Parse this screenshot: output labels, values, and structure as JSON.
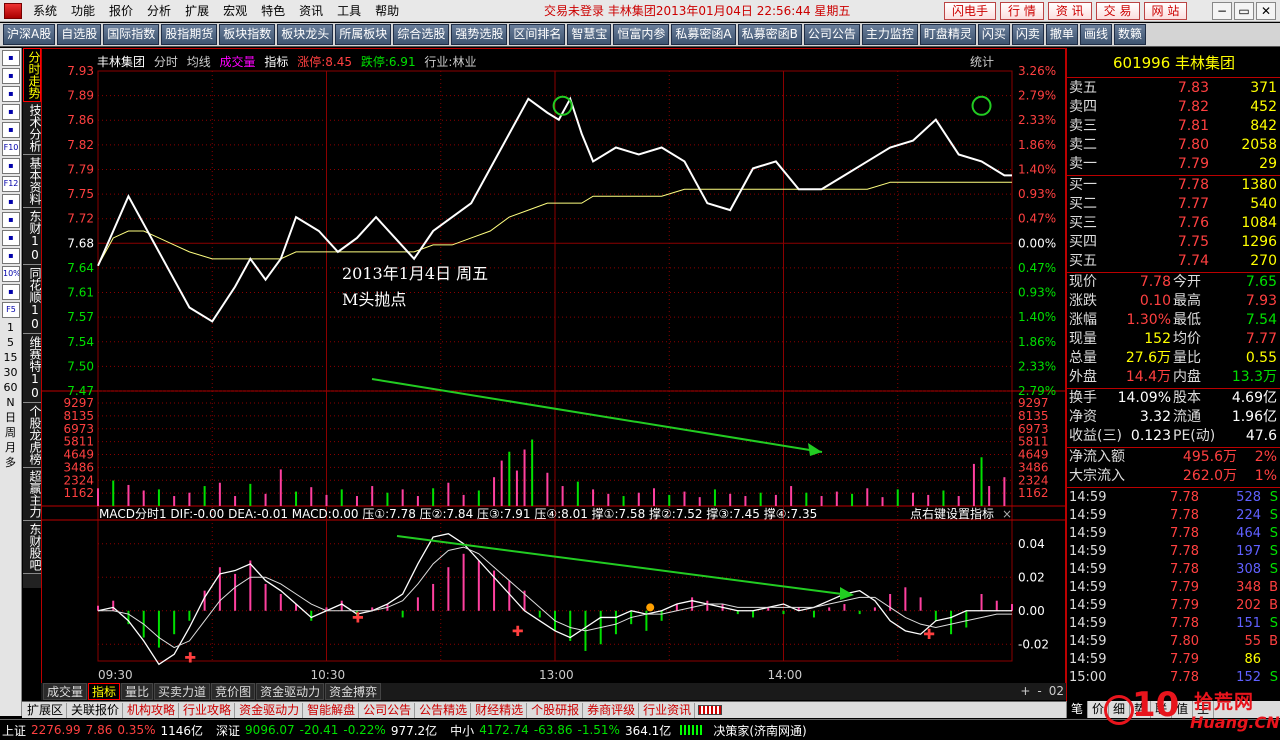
{
  "menubar": {
    "items": [
      "系统",
      "功能",
      "报价",
      "分析",
      "扩展",
      "宏观",
      "特色",
      "资讯",
      "工具",
      "帮助"
    ],
    "title": "交易未登录   丰林集团2013年01月04日  22:56:44  星期五",
    "quick_buttons": [
      "闪电手",
      "行 情",
      "资 讯",
      "交 易",
      "网 站"
    ],
    "window_controls": [
      "−",
      "▭",
      "✕"
    ]
  },
  "toolbar": {
    "items": [
      "沪深A股",
      "自选股",
      "国际指数",
      "股指期货",
      "板块指数",
      "板块龙头",
      "所属板块",
      "综合选股",
      "强势选股",
      "区间排名",
      "智慧宝",
      "恒富内参",
      "私募密函A",
      "私募密函B",
      "公司公告",
      "主力监控",
      "盯盘精灵",
      "闪买",
      "闪卖",
      "撤单",
      "画线",
      "数籁"
    ]
  },
  "leftbar": {
    "icons": [
      "list-icon",
      "grid-icon",
      "chart-icon",
      "table-icon",
      "window-icon",
      "F10",
      "doc-icon",
      "F12",
      "search-icon",
      "link-icon",
      "bar-icon",
      "monitor-icon",
      "10%",
      "pencil-icon",
      "F5"
    ],
    "labels": [
      "1",
      "5",
      "15",
      "30",
      "60",
      "N",
      "日",
      "周",
      "月",
      "多"
    ]
  },
  "vtabs": [
    "分时走势",
    "技术分析",
    "基本资料",
    "东财10",
    "同花顺10",
    "维赛特10",
    "个股龙虎榜",
    "超赢主力",
    "东财股吧"
  ],
  "chart": {
    "header": {
      "stock": "丰林集团",
      "mode": "分时",
      "avg_label": "均线",
      "vol_label": "成交量",
      "ind_label": "指标",
      "limit_up": "涨停:8.45",
      "limit_down": "跌停:6.91",
      "industry": "行业:林业"
    },
    "stats_label": "统计",
    "annotation_line1": "2013年1月4日  周五",
    "annotation_line2": "M头抛点",
    "macd_header": "MACD分时1  DIF:-0.00  DEA:-0.01  MACD:0.00  压①:7.78  压②:7.84  压③:7.91  压④:8.01  撑①:7.58  撑②:7.52  撑③:7.45  撑④:7.35",
    "macd_hint": "点右键设置指标",
    "time_labels": [
      "09:30",
      "10:30",
      "13:00",
      "14:00"
    ]
  },
  "chart_data": [
    {
      "type": "line",
      "title": "丰林集团 分时",
      "ylim": [
        7.47,
        7.93
      ],
      "y_ticks_left": [
        "7.93",
        "7.89",
        "7.86",
        "7.82",
        "7.79",
        "7.75",
        "7.72",
        "7.68",
        "7.64",
        "7.61",
        "7.57",
        "7.54",
        "7.50",
        "7.47"
      ],
      "y_ticks_right": [
        "3.26%",
        "2.79%",
        "2.33%",
        "1.86%",
        "1.40%",
        "0.93%",
        "0.47%",
        "0.00%",
        "0.47%",
        "0.93%",
        "1.40%",
        "1.86%",
        "2.33%",
        "2.79%"
      ],
      "x": [
        0,
        4,
        8,
        12,
        16,
        20,
        24,
        30,
        36,
        40,
        44,
        48,
        52,
        58,
        63,
        68,
        73,
        78,
        83,
        88,
        93,
        98,
        103,
        108,
        113,
        118,
        121,
        124,
        127,
        130,
        136,
        142,
        148,
        154,
        160,
        166,
        172,
        178,
        184,
        190,
        196,
        202,
        208,
        214,
        220,
        226,
        232,
        238,
        240
      ],
      "series": [
        {
          "name": "价格",
          "values": [
            7.65,
            7.7,
            7.75,
            7.71,
            7.67,
            7.63,
            7.59,
            7.57,
            7.62,
            7.66,
            7.63,
            7.66,
            7.72,
            7.7,
            7.67,
            7.69,
            7.72,
            7.69,
            7.66,
            7.7,
            7.72,
            7.74,
            7.79,
            7.84,
            7.89,
            7.87,
            7.86,
            7.89,
            7.84,
            7.8,
            7.82,
            7.81,
            7.82,
            7.8,
            7.74,
            7.73,
            7.79,
            7.8,
            7.76,
            7.76,
            7.78,
            7.8,
            7.82,
            7.83,
            7.86,
            7.81,
            7.8,
            7.78,
            7.78
          ]
        },
        {
          "name": "均价",
          "values": [
            7.65,
            7.69,
            7.7,
            7.7,
            7.69,
            7.68,
            7.67,
            7.66,
            7.66,
            7.66,
            7.66,
            7.66,
            7.67,
            7.67,
            7.67,
            7.67,
            7.67,
            7.67,
            7.67,
            7.68,
            7.68,
            7.69,
            7.7,
            7.72,
            7.73,
            7.74,
            7.74,
            7.74,
            7.74,
            7.75,
            7.75,
            7.75,
            7.75,
            7.76,
            7.76,
            7.76,
            7.76,
            7.76,
            7.76,
            7.76,
            7.76,
            7.76,
            7.77,
            7.77,
            7.77,
            7.77,
            7.77,
            7.77,
            7.77
          ]
        }
      ],
      "markers": [
        {
          "x": 122,
          "y": 7.88,
          "shape": "circle"
        },
        {
          "x": 232,
          "y": 7.88,
          "shape": "circle"
        }
      ]
    },
    {
      "type": "bar",
      "title": "成交量",
      "ylim": [
        0,
        9297
      ],
      "y_ticks": [
        "9297",
        "8135",
        "6973",
        "5811",
        "4649",
        "3486",
        "2324",
        "1162"
      ],
      "x": [
        0,
        4,
        8,
        12,
        16,
        20,
        24,
        28,
        32,
        36,
        40,
        44,
        48,
        52,
        56,
        60,
        64,
        68,
        72,
        76,
        80,
        84,
        88,
        92,
        96,
        100,
        104,
        106,
        108,
        110,
        112,
        114,
        118,
        122,
        126,
        130,
        134,
        138,
        142,
        146,
        150,
        154,
        158,
        162,
        166,
        170,
        174,
        178,
        182,
        186,
        190,
        194,
        198,
        202,
        206,
        210,
        214,
        218,
        222,
        226,
        230,
        232,
        234,
        238
      ],
      "values": [
        1600,
        2300,
        1900,
        1400,
        1500,
        900,
        1200,
        1800,
        2100,
        900,
        2000,
        1100,
        3300,
        1300,
        1700,
        1000,
        1500,
        900,
        1800,
        1200,
        1500,
        900,
        1600,
        2100,
        1000,
        1400,
        2600,
        4100,
        4900,
        3200,
        5100,
        6000,
        3000,
        1800,
        2200,
        1500,
        1100,
        900,
        1200,
        1600,
        1000,
        1300,
        800,
        1500,
        1100,
        900,
        1200,
        1000,
        1800,
        1200,
        900,
        1300,
        1100,
        1600,
        800,
        1500,
        1200,
        1000,
        1400,
        900,
        3800,
        4400,
        1800,
        2600
      ],
      "colors": [
        "red",
        "green"
      ]
    },
    {
      "type": "bar",
      "title": "MACD分时1",
      "ylim": [
        -0.03,
        0.05
      ],
      "y_ticks": [
        "0.04",
        "0.02",
        "0.00",
        "-0.02"
      ],
      "x": [
        0,
        4,
        8,
        12,
        16,
        20,
        24,
        28,
        32,
        36,
        40,
        44,
        48,
        52,
        56,
        60,
        64,
        68,
        72,
        76,
        80,
        84,
        88,
        92,
        96,
        100,
        104,
        108,
        112,
        116,
        120,
        124,
        128,
        132,
        136,
        140,
        144,
        148,
        152,
        156,
        160,
        164,
        168,
        172,
        176,
        180,
        184,
        188,
        192,
        196,
        200,
        204,
        208,
        212,
        216,
        220,
        224,
        228,
        232,
        236,
        240
      ],
      "values": [
        0.003,
        0.006,
        -0.008,
        -0.016,
        -0.022,
        -0.014,
        -0.006,
        0.012,
        0.026,
        0.022,
        0.03,
        0.016,
        0.01,
        0.004,
        -0.006,
        0.002,
        0.006,
        -0.004,
        0.002,
        0.004,
        -0.004,
        0.008,
        0.016,
        0.026,
        0.034,
        0.03,
        0.024,
        0.018,
        0.012,
        -0.004,
        -0.012,
        -0.018,
        -0.024,
        -0.02,
        -0.014,
        -0.008,
        -0.012,
        -0.006,
        0.004,
        0.008,
        0.006,
        0.004,
        -0.002,
        -0.004,
        0.002,
        -0.002,
        0.002,
        -0.004,
        0.002,
        0.004,
        -0.002,
        0.002,
        0.01,
        0.014,
        0.008,
        -0.006,
        -0.014,
        -0.01,
        0.01,
        0.006,
        0.004
      ],
      "series": [
        {
          "name": "DIF",
          "values": [
            0.0,
            0.002,
            -0.006,
            -0.018,
            -0.032,
            -0.026,
            -0.01,
            0.008,
            0.022,
            0.024,
            0.028,
            0.018,
            0.012,
            0.004,
            -0.004,
            0.0,
            0.004,
            -0.002,
            0.0,
            0.004,
            0.01,
            0.028,
            0.044,
            0.046,
            0.04,
            0.03,
            0.02,
            0.01,
            0.0,
            -0.006,
            -0.012,
            -0.016,
            -0.01,
            -0.004,
            -0.004,
            0.0,
            -0.002,
            0.0,
            0.004,
            0.006,
            0.004,
            0.002,
            0.0,
            0.0,
            0.002,
            0.004,
            0.0,
            0.002,
            0.006,
            0.01,
            0.012,
            0.006,
            -0.006,
            -0.012,
            -0.014,
            -0.006,
            -0.004,
            0.0,
            0.0,
            0.0,
            0.0
          ]
        },
        {
          "name": "DEA",
          "values": [
            0.0,
            0.0,
            -0.002,
            -0.008,
            -0.016,
            -0.022,
            -0.018,
            -0.006,
            0.006,
            0.014,
            0.02,
            0.02,
            0.016,
            0.01,
            0.004,
            0.0,
            0.0,
            0.0,
            0.0,
            0.002,
            0.006,
            0.016,
            0.028,
            0.036,
            0.038,
            0.034,
            0.026,
            0.018,
            0.01,
            0.002,
            -0.006,
            -0.01,
            -0.012,
            -0.01,
            -0.008,
            -0.004,
            -0.002,
            -0.002,
            0.0,
            0.002,
            0.004,
            0.004,
            0.002,
            0.002,
            0.002,
            0.002,
            0.002,
            0.002,
            0.004,
            0.006,
            0.008,
            0.008,
            0.002,
            -0.004,
            -0.008,
            -0.01,
            -0.008,
            -0.006,
            -0.004,
            -0.002,
            -0.002
          ]
        }
      ],
      "markers": [
        {
          "x": 24,
          "y": -0.028,
          "shape": "cross"
        },
        {
          "x": 68,
          "y": -0.004,
          "shape": "cross"
        },
        {
          "x": 110,
          "y": -0.012,
          "shape": "cross"
        },
        {
          "x": 145,
          "y": 0.002,
          "shape": "dot"
        },
        {
          "x": 218,
          "y": -0.014,
          "shape": "cross"
        }
      ]
    }
  ],
  "bottom_tabs": [
    "成交量",
    "指标",
    "量比",
    "买卖力道",
    "竞价图",
    "资金驱动力",
    "资金搏弈"
  ],
  "zoom_ctrls": [
    "+",
    "-",
    "02"
  ],
  "info_bar": [
    "扩展区",
    "关联报价",
    "机构攻略",
    "行业攻略",
    "资金驱动力",
    "智能解盘",
    "公司公告",
    "公告精选",
    "财经精选",
    "个股研报",
    "券商评级",
    "行业资讯"
  ],
  "right_panel": {
    "code_name": "601996  丰林集团",
    "sell": [
      {
        "label": "卖五",
        "price": "7.83",
        "vol": "371"
      },
      {
        "label": "卖四",
        "price": "7.82",
        "vol": "452"
      },
      {
        "label": "卖三",
        "price": "7.81",
        "vol": "842"
      },
      {
        "label": "卖二",
        "price": "7.80",
        "vol": "2058"
      },
      {
        "label": "卖一",
        "price": "7.79",
        "vol": "29"
      }
    ],
    "buy": [
      {
        "label": "买一",
        "price": "7.78",
        "vol": "1380"
      },
      {
        "label": "买二",
        "price": "7.77",
        "vol": "540"
      },
      {
        "label": "买三",
        "price": "7.76",
        "vol": "1084"
      },
      {
        "label": "买四",
        "price": "7.75",
        "vol": "1296"
      },
      {
        "label": "买五",
        "price": "7.74",
        "vol": "270"
      }
    ],
    "stats": [
      {
        "l1": "现价",
        "v1": "7.78",
        "c1": "red",
        "l2": "今开",
        "v2": "7.65",
        "c2": "grn"
      },
      {
        "l1": "涨跌",
        "v1": "0.10",
        "c1": "red",
        "l2": "最高",
        "v2": "7.93",
        "c2": "red"
      },
      {
        "l1": "涨幅",
        "v1": "1.30%",
        "c1": "red",
        "l2": "最低",
        "v2": "7.54",
        "c2": "grn"
      },
      {
        "l1": "现量",
        "v1": "152",
        "c1": "yel",
        "l2": "均价",
        "v2": "7.77",
        "c2": "red"
      },
      {
        "l1": "总量",
        "v1": "27.6万",
        "c1": "yel",
        "l2": "量比",
        "v2": "0.55",
        "c2": "yel"
      },
      {
        "l1": "外盘",
        "v1": "14.4万",
        "c1": "red",
        "l2": "内盘",
        "v2": "13.3万",
        "c2": "grn"
      },
      {
        "l1": "换手",
        "v1": "14.09%",
        "c1": "wht",
        "l2": "股本",
        "v2": "4.69亿",
        "c2": "wht"
      },
      {
        "l1": "净资",
        "v1": "3.32",
        "c1": "wht",
        "l2": "流通",
        "v2": "1.96亿",
        "c2": "wht"
      },
      {
        "l1": "收益(三)",
        "v1": "0.123",
        "c1": "wht",
        "l2": "PE(动)",
        "v2": "47.6",
        "c2": "wht"
      }
    ],
    "flows": [
      {
        "label": "净流入额",
        "v1": "495.6万",
        "v2": "2%"
      },
      {
        "label": "大宗流入",
        "v1": "262.0万",
        "v2": "1%"
      }
    ],
    "ticks": [
      {
        "t": "14:59",
        "p": "7.78",
        "v": "528",
        "f": "S"
      },
      {
        "t": "14:59",
        "p": "7.78",
        "v": "224",
        "f": "S"
      },
      {
        "t": "14:59",
        "p": "7.78",
        "v": "464",
        "f": "S"
      },
      {
        "t": "14:59",
        "p": "7.78",
        "v": "197",
        "f": "S"
      },
      {
        "t": "14:59",
        "p": "7.78",
        "v": "308",
        "f": "S"
      },
      {
        "t": "14:59",
        "p": "7.79",
        "v": "348",
        "f": "B"
      },
      {
        "t": "14:59",
        "p": "7.79",
        "v": "202",
        "f": "B"
      },
      {
        "t": "14:59",
        "p": "7.78",
        "v": "151",
        "f": "S"
      },
      {
        "t": "14:59",
        "p": "7.80",
        "v": "55",
        "f": "B"
      },
      {
        "t": "14:59",
        "p": "7.79",
        "v": "86",
        "f": ""
      },
      {
        "t": "15:00",
        "p": "7.78",
        "v": "152",
        "f": "S"
      }
    ]
  },
  "rp_tabs": [
    "笔",
    "价",
    "细",
    "势",
    "联",
    "值",
    "主"
  ],
  "statusbar": {
    "sh_label": "上证",
    "sh_val": "2276.99",
    "sh_chg": "7.86",
    "sh_pct": "0.35%",
    "sh_amt": "1146亿",
    "sz_label": "深证",
    "sz_val": "9096.07",
    "sz_chg": "-20.41",
    "sz_pct": "-0.22%",
    "sz_amt": "977.2亿",
    "zx_label": "中小",
    "zx_val": "4172.74",
    "zx_chg": "-63.86",
    "zx_pct": "-1.51%",
    "zx_amt": "364.1亿",
    "broker": "决策家(济南网通)"
  },
  "watermark": {
    "num": "10",
    "cn": "拾荒网",
    "url": "Huang.CN"
  },
  "colors": {
    "up": "#ff4040",
    "down": "#00e000",
    "price_line": "#ffffff",
    "avg_line": "#ffff80",
    "grid": "#8b0000",
    "arrow": "#22cc22"
  }
}
